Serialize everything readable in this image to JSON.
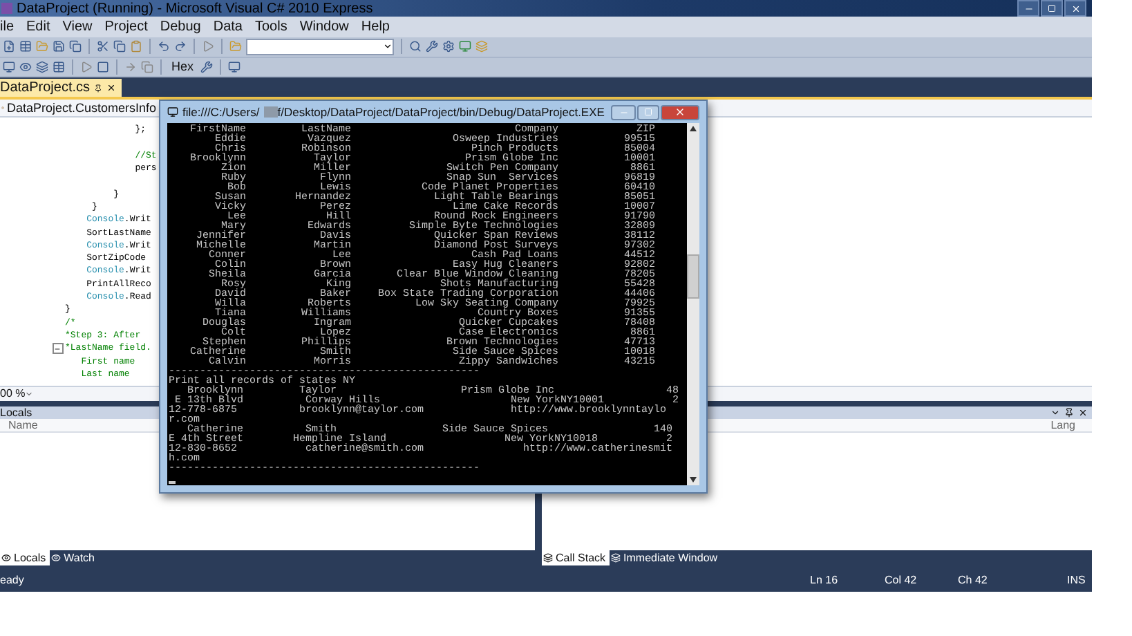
{
  "window": {
    "title": "DataProject (Running) - Microsoft Visual C# 2010 Express"
  },
  "menu": [
    "ile",
    "Edit",
    "View",
    "Project",
    "Debug",
    "Data",
    "Tools",
    "Window",
    "Help"
  ],
  "toolbar": {
    "hex_label": "Hex"
  },
  "document_tabs": [
    {
      "label": "DataProject.cs",
      "selected": true
    }
  ],
  "editor": {
    "type_combo": "DataProject.CustomersInfo",
    "zoom": "00 %",
    "lines": [
      {
        "gap_before": false,
        "tokens": [
          {
            "text": "             };",
            "kind": "plain"
          }
        ]
      },
      {
        "gap_before": true,
        "tokens": [
          {
            "text": "             //St",
            "kind": "comment"
          }
        ]
      },
      {
        "gap_before": false,
        "tokens": [
          {
            "text": "             pers",
            "kind": "plain"
          }
        ]
      },
      {
        "gap_before": true,
        "tokens": [
          {
            "text": "         }",
            "kind": "plain"
          }
        ]
      },
      {
        "gap_before": false,
        "tokens": [
          {
            "text": "     }",
            "kind": "plain"
          }
        ]
      },
      {
        "gap_before": false,
        "tokens": [
          {
            "text": "    Console",
            "kind": "type"
          },
          {
            "text": ".Writ",
            "kind": "plain"
          }
        ]
      },
      {
        "gap_before": false,
        "tokens": [
          {
            "text": "    SortLastName",
            "kind": "plain"
          }
        ]
      },
      {
        "gap_before": false,
        "tokens": [
          {
            "text": "    Console",
            "kind": "type"
          },
          {
            "text": ".Writ",
            "kind": "plain"
          }
        ]
      },
      {
        "gap_before": false,
        "tokens": [
          {
            "text": "    SortZipCode",
            "kind": "plain"
          }
        ]
      },
      {
        "gap_before": false,
        "tokens": [
          {
            "text": "    Console",
            "kind": "type"
          },
          {
            "text": ".Writ",
            "kind": "plain"
          }
        ]
      },
      {
        "gap_before": false,
        "tokens": [
          {
            "text": "    PrintAllReco",
            "kind": "plain"
          }
        ]
      },
      {
        "gap_before": false,
        "tokens": [
          {
            "text": "    Console",
            "kind": "type"
          },
          {
            "text": ".Read",
            "kind": "plain"
          }
        ]
      },
      {
        "gap_before": false,
        "tokens": [
          {
            "text": "}",
            "kind": "plain"
          }
        ]
      },
      {
        "gap_before": false,
        "tokens": [
          {
            "text": "/*",
            "kind": "comment"
          }
        ]
      },
      {
        "gap_before": false,
        "tokens": [
          {
            "text": "*Step 3: After",
            "kind": "comment"
          }
        ]
      },
      {
        "gap_before": false,
        "tokens": [
          {
            "text": "*LastName field.",
            "kind": "comment"
          }
        ]
      },
      {
        "gap_before": false,
        "tokens": [
          {
            "text": "   First name",
            "kind": "comment"
          }
        ]
      },
      {
        "gap_before": false,
        "tokens": [
          {
            "text": "   Last name",
            "kind": "comment"
          }
        ]
      }
    ]
  },
  "console": {
    "title_start": "file:///C:/Users/",
    "title_end": "f/Desktop/DataProject/DataProject/bin/Debug/DataProject.EXE",
    "header": [
      "FirstName",
      "LastName",
      "Company",
      "ZIP"
    ],
    "rows": [
      [
        "Eddie",
        "Vazquez",
        "Osweep Industries",
        "99515"
      ],
      [
        "Chris",
        "Robinson",
        "Pinch Products",
        "85004"
      ],
      [
        "Brooklynn",
        "Taylor",
        "Prism Globe Inc",
        "10001"
      ],
      [
        "Zion",
        "Miller",
        "Switch Pen Company",
        "8861"
      ],
      [
        "Ruby",
        "Flynn",
        "Snap Sun  Services",
        "96819"
      ],
      [
        "Bob",
        "Lewis",
        "Code Planet Properties",
        "60410"
      ],
      [
        "Susan",
        "Hernandez",
        "Light Table Bearings",
        "85051"
      ],
      [
        "Vicky",
        "Perez",
        "Lime Cake Records",
        "10007"
      ],
      [
        "Lee",
        "Hill",
        "Round Rock Engineers",
        "91790"
      ],
      [
        "Mary",
        "Edwards",
        "Simple Byte Technologies",
        "32809"
      ],
      [
        "Jennifer",
        "Davis",
        "Quicker Span Reviews",
        "38112"
      ],
      [
        "Michelle",
        "Martin",
        "Diamond Post Surveys",
        "97302"
      ],
      [
        "Conner",
        "Lee",
        "Cash Pad Loans",
        "44512"
      ],
      [
        "Colin",
        "Brown",
        "Easy Hug Cleaners",
        "92802"
      ],
      [
        "Sheila",
        "Garcia",
        "Clear Blue Window Cleaning",
        "78205"
      ],
      [
        "Rosy",
        "King",
        "Shots Manufacturing",
        "55428"
      ],
      [
        "David",
        "Baker",
        "Box State Trading Corporation",
        "44406"
      ],
      [
        "Willa",
        "Roberts",
        "Low Sky Seating Company",
        "79925"
      ],
      [
        "Tiana",
        "Williams",
        "Country Boxes",
        "91355"
      ],
      [
        "Douglas",
        "Ingram",
        "Quicker Cupcakes",
        "78408"
      ],
      [
        "Colt",
        "Lopez",
        "Case Electronics",
        "8861"
      ],
      [
        "Stephen",
        "Phillips",
        "Brown Technologies",
        "47713"
      ],
      [
        "Catherine",
        "Smith",
        "Side Sauce Spices",
        "10018"
      ],
      [
        "Calvin",
        "Morris",
        "Zippy Sandwiches",
        "43215"
      ]
    ],
    "lines": [
      "--------------------------------------------------",
      "Print all records of states NY",
      "   Brooklynn         Taylor                    Prism Globe Inc                  48",
      " E 13th Blvd          Corway Hills                     New YorkNY10001           2",
      "12-778-6875          brooklynn@taylor.com              http://www.brooklynntaylo",
      "r.com",
      "   Catherine          Smith                 Side Sauce Spices                 140",
      "E 4th Street        Hempline Island                   New YorkNY10018           2",
      "12-830-8652           catherine@smith.com                http://www.catherinesmit",
      "h.com",
      "--------------------------------------------------"
    ]
  },
  "locals_panel": {
    "title": "Locals",
    "columns": [
      "Name"
    ]
  },
  "right_panel": {
    "columns": [
      "Lang"
    ]
  },
  "left_tabs": [
    {
      "label": "Locals",
      "selected": true
    },
    {
      "label": "Watch",
      "selected": false
    }
  ],
  "right_tabs": [
    {
      "label": "Call Stack",
      "selected": true
    },
    {
      "label": "Immediate Window",
      "selected": false
    }
  ],
  "status_bar": {
    "message": "eady",
    "line": "Ln 16",
    "column": "Col 42",
    "char": "Ch 42",
    "mode": "INS"
  }
}
